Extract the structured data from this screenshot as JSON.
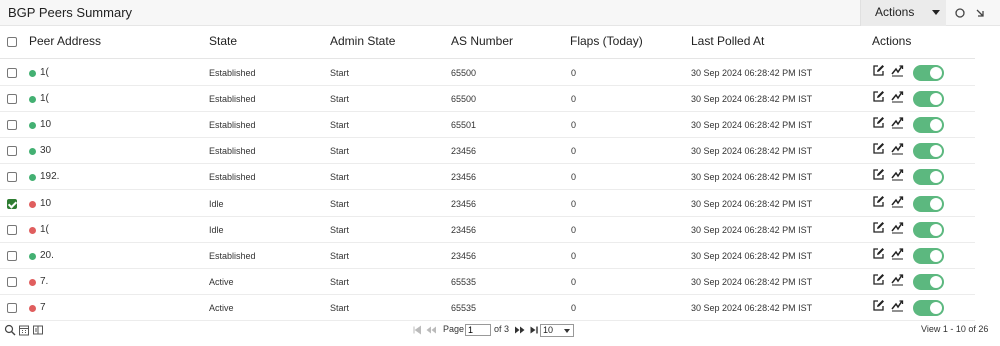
{
  "widget": {
    "title": "BGP Peers Summary",
    "actions_label": "Actions"
  },
  "columns": {
    "peer_address": "Peer Address",
    "state": "State",
    "admin_state": "Admin State",
    "as_number": "AS Number",
    "flaps": "Flaps (Today)",
    "last_polled": "Last Polled At",
    "actions": "Actions"
  },
  "colors": {
    "status_up": "#43b072",
    "status_down": "#e05e5e",
    "toggle_on": "#5cb87f",
    "checked": "#2e7d32"
  },
  "rows": [
    {
      "peer": "1(",
      "status": "up",
      "state": "Established",
      "admin_state": "Start",
      "as_number": "65500",
      "flaps": "0",
      "last_polled": "30 Sep 2024 06:28:42 PM IST",
      "checked": false,
      "enabled": true
    },
    {
      "peer": "1(",
      "status": "up",
      "state": "Established",
      "admin_state": "Start",
      "as_number": "65500",
      "flaps": "0",
      "last_polled": "30 Sep 2024 06:28:42 PM IST",
      "checked": false,
      "enabled": true
    },
    {
      "peer": "10",
      "status": "up",
      "state": "Established",
      "admin_state": "Start",
      "as_number": "65501",
      "flaps": "0",
      "last_polled": "30 Sep 2024 06:28:42 PM IST",
      "checked": false,
      "enabled": true
    },
    {
      "peer": "30",
      "status": "up",
      "state": "Established",
      "admin_state": "Start",
      "as_number": "23456",
      "flaps": "0",
      "last_polled": "30 Sep 2024 06:28:42 PM IST",
      "checked": false,
      "enabled": true
    },
    {
      "peer": "192.",
      "status": "up",
      "state": "Established",
      "admin_state": "Start",
      "as_number": "23456",
      "flaps": "0",
      "last_polled": "30 Sep 2024 06:28:42 PM IST",
      "checked": false,
      "enabled": true
    },
    {
      "peer": "10",
      "status": "down",
      "state": "Idle",
      "admin_state": "Start",
      "as_number": "23456",
      "flaps": "0",
      "last_polled": "30 Sep 2024 06:28:42 PM IST",
      "checked": true,
      "enabled": true
    },
    {
      "peer": "1(",
      "status": "down",
      "state": "Idle",
      "admin_state": "Start",
      "as_number": "23456",
      "flaps": "0",
      "last_polled": "30 Sep 2024 06:28:42 PM IST",
      "checked": false,
      "enabled": true
    },
    {
      "peer": "20.",
      "status": "up",
      "state": "Established",
      "admin_state": "Start",
      "as_number": "23456",
      "flaps": "0",
      "last_polled": "30 Sep 2024 06:28:42 PM IST",
      "checked": false,
      "enabled": true
    },
    {
      "peer": "7.",
      "status": "down",
      "state": "Active",
      "admin_state": "Start",
      "as_number": "65535",
      "flaps": "0",
      "last_polled": "30 Sep 2024 06:28:42 PM IST",
      "checked": false,
      "enabled": true
    },
    {
      "peer": "7",
      "status": "down",
      "state": "Active",
      "admin_state": "Start",
      "as_number": "65535",
      "flaps": "0",
      "last_polled": "30 Sep 2024 06:28:42 PM IST",
      "checked": false,
      "enabled": true
    }
  ],
  "pagination": {
    "page_label": "Page",
    "current_page": "1",
    "of_label": "of 3",
    "per_page": "10",
    "view_label": "View 1 - 10 of 26"
  },
  "icons": {
    "header": [
      "refresh-icon",
      "minimize-icon"
    ],
    "row": [
      "edit-icon",
      "trend-chart-icon",
      "toggle-switch"
    ],
    "footer": [
      "search-icon",
      "calendar-icon",
      "columns-icon"
    ],
    "pager": [
      "first-page-icon",
      "prev-page-icon",
      "next-page-icon",
      "last-page-icon"
    ]
  }
}
